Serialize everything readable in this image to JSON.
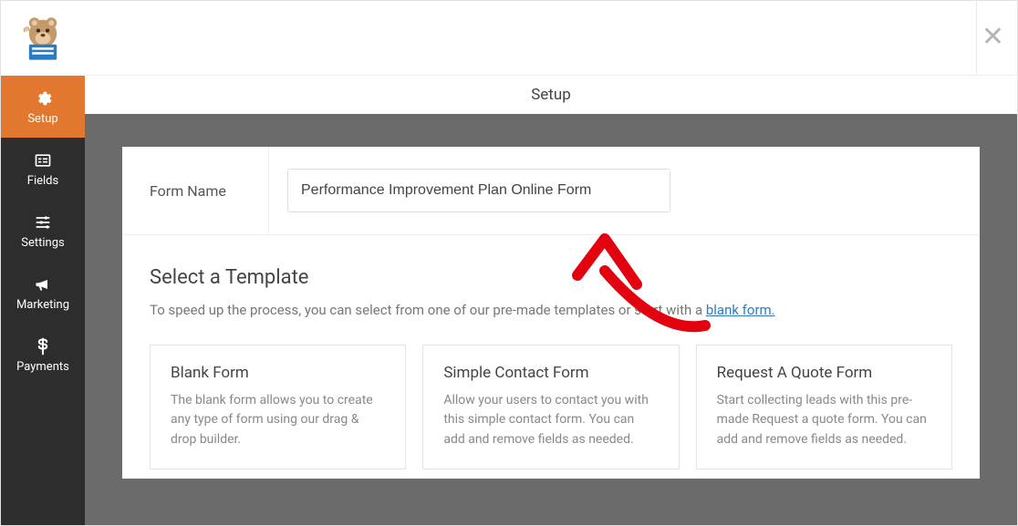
{
  "sidebar": {
    "items": [
      {
        "label": "Setup",
        "icon": "gear-icon",
        "active": true
      },
      {
        "label": "Fields",
        "icon": "list-icon",
        "active": false
      },
      {
        "label": "Settings",
        "icon": "sliders-icon",
        "active": false
      },
      {
        "label": "Marketing",
        "icon": "bullhorn-icon",
        "active": false
      },
      {
        "label": "Payments",
        "icon": "dollar-icon",
        "active": false
      }
    ]
  },
  "header": {
    "title": "Setup"
  },
  "form_name": {
    "label": "Form Name",
    "value": "Performance Improvement Plan Online Form"
  },
  "template_section": {
    "title": "Select a Template",
    "description_pre": "To speed up the process, you can select from one of our pre-made templates or start with a ",
    "link_text": "blank form.",
    "cards": [
      {
        "title": "Blank Form",
        "desc": "The blank form allows you to create any type of form using our drag & drop builder."
      },
      {
        "title": "Simple Contact Form",
        "desc": "Allow your users to contact you with this simple contact form. You can add and remove fields as needed."
      },
      {
        "title": "Request A Quote Form",
        "desc": "Start collecting leads with this pre-made Request a quote form. You can add and remove fields as needed."
      }
    ]
  },
  "close_label": "✕"
}
